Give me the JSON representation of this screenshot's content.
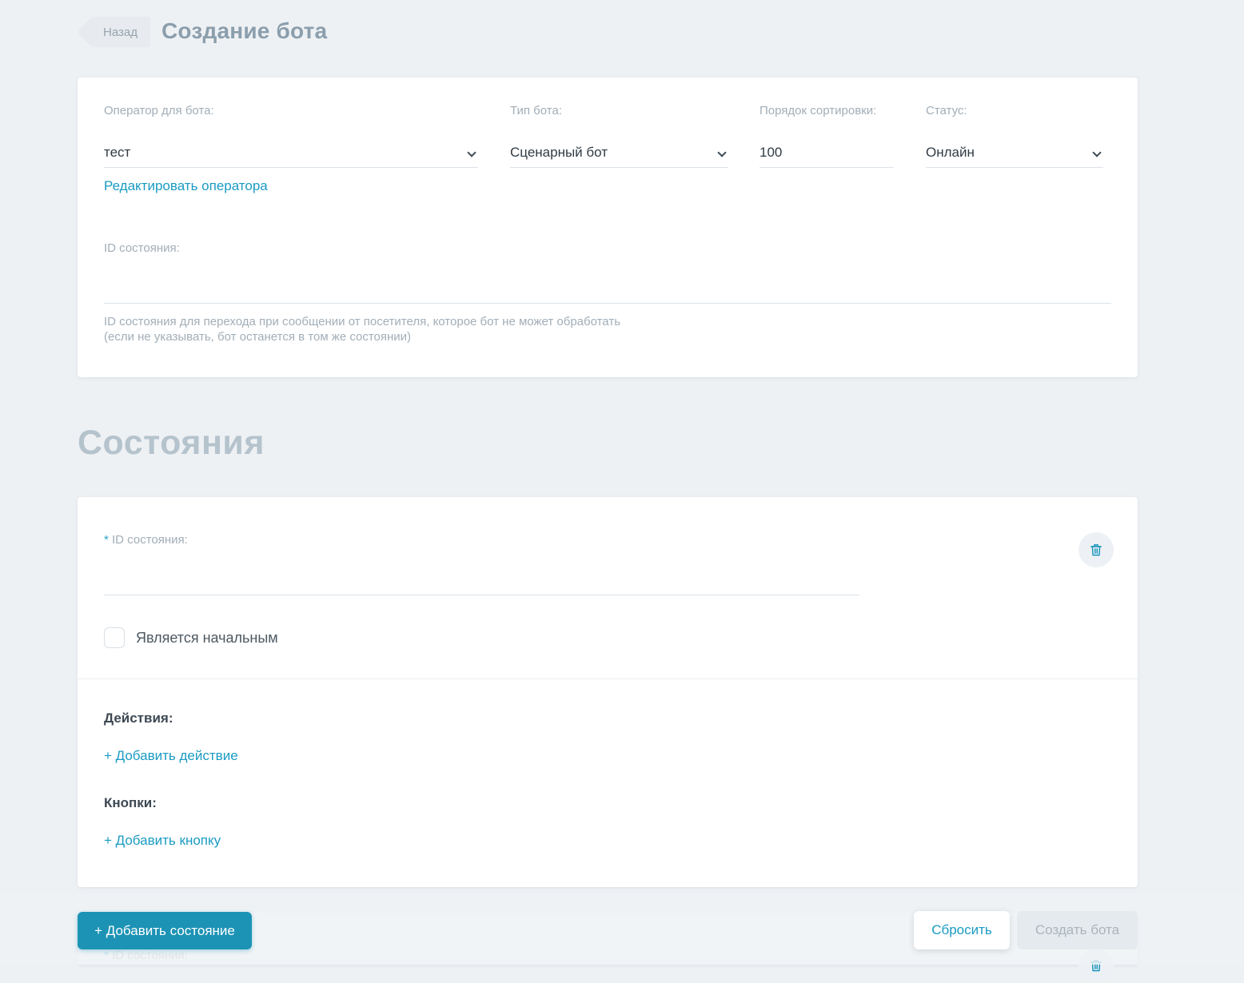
{
  "colors": {
    "page_bg": "#eef1f4",
    "accent_link": "#1a9bc2",
    "primary_button_bg": "#1c93b5",
    "title_text": "#8b9eac",
    "section_heading_text": "#b5c3cd",
    "label_text": "#a2aeb8",
    "value_text": "#303b44",
    "disabled_button_bg": "#e5eaee",
    "disabled_button_text": "#a9b4bd"
  },
  "header": {
    "back_label": "Назад",
    "title": "Создание бота"
  },
  "settings_card": {
    "fields": {
      "operator": {
        "label": "Оператор для бота:",
        "value": "тест"
      },
      "bot_type": {
        "label": "Тип бота:",
        "value": "Сценарный бот"
      },
      "sort_order": {
        "label": "Порядок сортировки:",
        "value": "100"
      },
      "status": {
        "label": "Статус:",
        "value": "Онлайн"
      }
    },
    "edit_operator_link": "Редактировать оператора",
    "state_id": {
      "label": "ID состояния:",
      "value": "",
      "hint_line1": "ID состояния для перехода при сообщении от посетителя, которое бот не может обработать",
      "hint_line2": "(если не указывать, бот останется в том же состоянии)"
    }
  },
  "states_section": {
    "heading": "Состояния",
    "state_card": {
      "required_mark": "*",
      "id_label": "ID состояния:",
      "id_value": "",
      "checkbox_label": "Является начальным",
      "checkbox_checked": false,
      "actions_label": "Действия:",
      "add_action_link": "+ Добавить действие",
      "buttons_label": "Кнопки:",
      "add_button_link": "+ Добавить кнопку"
    }
  },
  "footer": {
    "add_state_button": "+ Добавить состояние",
    "reset_button": "Сбросить",
    "create_button": "Создать бота"
  },
  "icons": {
    "back_arrow": "arrow-left-icon",
    "select_chevron": "chevron-down-icon",
    "delete_state": "trash-icon"
  }
}
